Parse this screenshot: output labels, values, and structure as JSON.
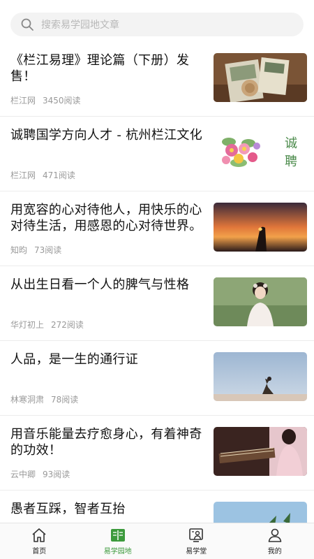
{
  "search": {
    "placeholder": "搜索易学园地文章"
  },
  "articles": [
    {
      "title": "《栏江易理》理论篇（下册）发售！",
      "author": "栏江网",
      "reads": "3450阅读"
    },
    {
      "title": "诚聘国学方向人才 - 杭州栏江文化",
      "author": "栏江网",
      "reads": "471阅读"
    },
    {
      "title": "用宽容的心对待他人，用快乐的心对待生活，用感恩的心对待世界。",
      "author": "知昀",
      "reads": "73阅读"
    },
    {
      "title": "从出生日看一个人的脾气与性格",
      "author": "华灯初上",
      "reads": "272阅读"
    },
    {
      "title": "人品，是一生的通行证",
      "author": "林寒洞肃",
      "reads": "78阅读"
    },
    {
      "title": "用音乐能量去疗愈身心，有着神奇的功效！",
      "author": "云中卿",
      "reads": "93阅读"
    },
    {
      "title": "愚者互踩，智者互抬",
      "author": "",
      "reads": ""
    }
  ],
  "thumb_text": {
    "recruit": "诚\n聘",
    "recruit_1": "诚",
    "recruit_2": "聘"
  },
  "tabs": [
    {
      "label": "首页",
      "icon": "home-icon"
    },
    {
      "label": "易学园地",
      "icon": "book-icon"
    },
    {
      "label": "易学堂",
      "icon": "classroom-icon"
    },
    {
      "label": "我的",
      "icon": "user-icon"
    }
  ],
  "colors": {
    "accent": "#3c9a3c",
    "muted": "#999999"
  }
}
